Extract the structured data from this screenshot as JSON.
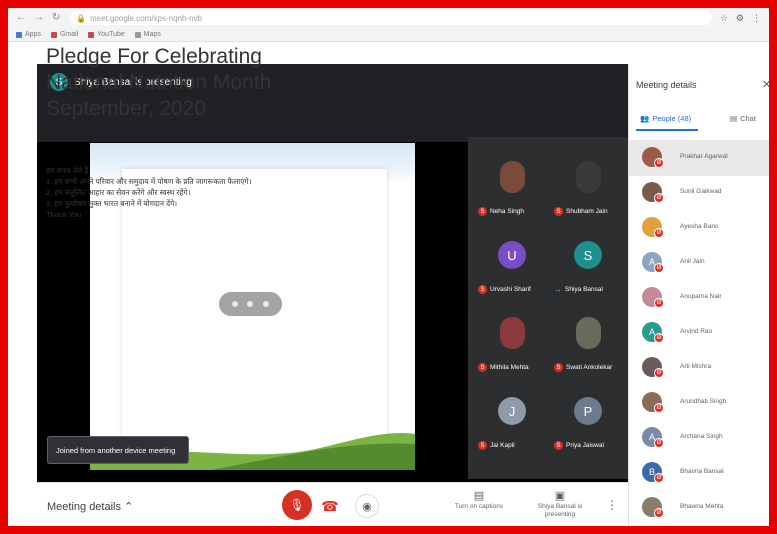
{
  "browser": {
    "url": "meet.google.com/xps-nqnh-nvb",
    "bookmarks": [
      "Apps",
      "Gmail",
      "YouTube",
      "Maps"
    ]
  },
  "presenter": {
    "initial": "S",
    "label": "Shiya Bansal is presenting"
  },
  "slide": {
    "title": "Pledge For Celebrating National Nutrition Month September, 2020",
    "body_lines": [
      "हम शपथ लेते हैं",
      "1. हम सभी अपने परिवार और समुदाय में पोषण के प्रति जागरूकता फैलाएंगे।",
      "2. हम संतुलित आहार का सेवन करेंगे और स्वस्थ रहेंगे।",
      "3. हम कुपोषण मुक्त भारत बनाने में योगदान देंगे।",
      "Thank You"
    ]
  },
  "toast": {
    "text": "Joined from another device meeting"
  },
  "tiles": [
    {
      "name": "Neha Singh",
      "initial": "",
      "color": "#7a4a3a",
      "muted": true
    },
    {
      "name": "Shubham Jain",
      "initial": "",
      "color": "#3a3a3a",
      "muted": true
    },
    {
      "name": "Urvashi Sharif",
      "initial": "U",
      "color": "#7b4fc4",
      "muted": true
    },
    {
      "name": "Shiya Bansal",
      "initial": "S",
      "color": "#1e8e8e",
      "muted": false
    },
    {
      "name": "Mithila Mehta",
      "initial": "",
      "color": "#8a3a3a",
      "muted": true
    },
    {
      "name": "Swati Ankolekar",
      "initial": "",
      "color": "#6a6a5a",
      "muted": true
    },
    {
      "name": "Jai Kapil",
      "initial": "J",
      "color": "#8e9aa8",
      "muted": true
    },
    {
      "name": "Priya Jaiswal",
      "initial": "P",
      "color": "#6b7b8c",
      "muted": true
    }
  ],
  "controls": {
    "details_label": "Meeting details",
    "turn_on_captions": "Turn on captions",
    "present_label": "Shiya Bansal is presenting"
  },
  "panel": {
    "title": "Meeting details",
    "tab_people": "People (48)",
    "tab_chat": "Chat",
    "people": [
      {
        "name": "Prakhar Agarwal",
        "initial": "",
        "color": "#9c5a4a",
        "highlight": true
      },
      {
        "name": "Sunil Gaikwad",
        "initial": "",
        "color": "#7a5a4a",
        "highlight": false
      },
      {
        "name": "Ayesha Bano",
        "initial": "",
        "color": "#e2a23a",
        "highlight": false
      },
      {
        "name": "Anil Jain",
        "initial": "A",
        "color": "#8da5bf",
        "highlight": false
      },
      {
        "name": "Anupama Nair",
        "initial": "",
        "color": "#c58a9a",
        "highlight": false
      },
      {
        "name": "Arvind Rao",
        "initial": "A",
        "color": "#2a9a8a",
        "highlight": false
      },
      {
        "name": "Arti Mishra",
        "initial": "",
        "color": "#6a5a5a",
        "highlight": false
      },
      {
        "name": "Arundhati Singh",
        "initial": "",
        "color": "#8a6a5a",
        "highlight": false
      },
      {
        "name": "Archana Singh",
        "initial": "A",
        "color": "#7a8aa8",
        "highlight": false
      },
      {
        "name": "Bhavna Bansal",
        "initial": "B",
        "color": "#3a6aa8",
        "highlight": false
      },
      {
        "name": "Bhawna Mehta",
        "initial": "",
        "color": "#8a7a6a",
        "highlight": false
      }
    ]
  }
}
